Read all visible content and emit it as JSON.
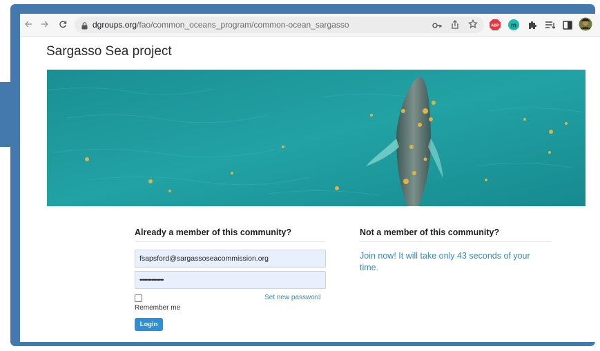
{
  "browser": {
    "url_host": "dgroups.org",
    "url_path": "/fao/common_oceans_program/common-ocean_sargasso",
    "extensions": [
      "back-icon",
      "forward-icon",
      "reload-icon",
      "lock-icon",
      "key-icon",
      "share-icon",
      "star-icon",
      "abp-extension-icon",
      "m-extension-icon",
      "puzzle-icon",
      "reading-list-icon",
      "side-panel-icon",
      "profile-avatar"
    ],
    "abp_label": "ABP",
    "m_label": "m"
  },
  "page": {
    "title": "Sargasso Sea project"
  },
  "login": {
    "heading": "Already a member of this community?",
    "email_value": "fsapsford@sargassoseacommission.org",
    "password_value": "••••••••••••••••",
    "remember_label": "Remember me",
    "set_password_link": "Set new password",
    "login_button": "Login"
  },
  "join": {
    "heading": "Not a member of this community?",
    "text": "Join now! It will take only 43 seconds of your time."
  },
  "colors": {
    "frame": "#4479ad",
    "sea": "#1f9b9d",
    "link": "#3d86b8",
    "login_button": "#2d8fd5"
  }
}
